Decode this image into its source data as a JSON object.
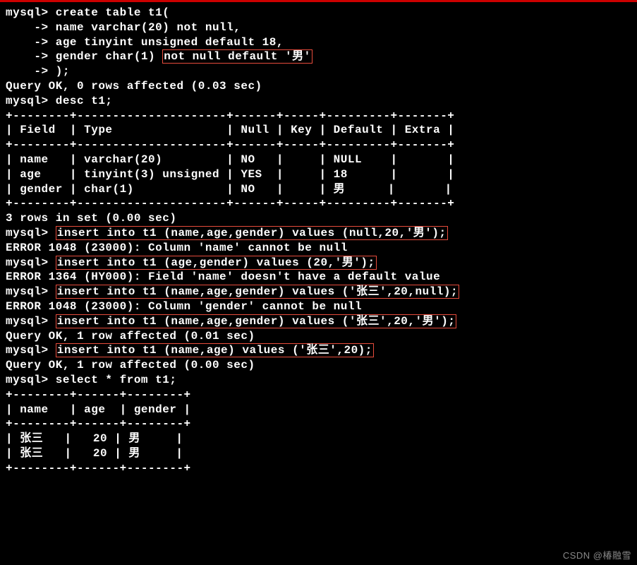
{
  "lines": {
    "l1": "mysql> create table t1(",
    "l2": "    -> name varchar(20) not null,",
    "l3": "    -> age tinyint unsigned default 18,",
    "l4a": "    -> gender char(1) ",
    "l4b": "not null default '男'",
    "l5": "    -> );",
    "l6": "Query OK, 0 rows affected (0.03 sec)",
    "l7": "",
    "l8": "mysql> desc t1;",
    "l9": "+--------+---------------------+------+-----+---------+-------+",
    "l10": "| Field  | Type                | Null | Key | Default | Extra |",
    "l11": "+--------+---------------------+------+-----+---------+-------+",
    "l12": "| name   | varchar(20)         | NO   |     | NULL    |       |",
    "l13": "| age    | tinyint(3) unsigned | YES  |     | 18      |       |",
    "l14": "| gender | char(1)             | NO   |     | 男      |       |",
    "l15": "+--------+---------------------+------+-----+---------+-------+",
    "l16": "3 rows in set (0.00 sec)",
    "l17": "",
    "l18a": "mysql> ",
    "l18b": "insert into t1 (name,age,gender) values (null,20,'男');",
    "l19": "ERROR 1048 (23000): Column 'name' cannot be null",
    "l20a": "mysql> ",
    "l20b": "insert into t1 (age,gender) values (20,'男');",
    "l21": "ERROR 1364 (HY000): Field 'name' doesn't have a default value",
    "l22a": "mysql> ",
    "l22b": "insert into t1 (name,age,gender) values ('张三',20,null);",
    "l23": "ERROR 1048 (23000): Column 'gender' cannot be null",
    "l24a": "mysql> ",
    "l24b": "insert into t1 (name,age,gender) values ('张三',20,'男');",
    "l25": "Query OK, 1 row affected (0.01 sec)",
    "l26": "",
    "l27a": "mysql> ",
    "l27b": "insert into t1 (name,age) values ('张三',20);",
    "l28": "Query OK, 1 row affected (0.00 sec)",
    "l29": "",
    "l30": "mysql> select * from t1;",
    "l31": "+--------+------+--------+",
    "l32": "| name   | age  | gender |",
    "l33": "+--------+------+--------+",
    "l34": "| 张三   |   20 | 男     |",
    "l35": "| 张三   |   20 | 男     |",
    "l36": "+--------+------+--------+"
  },
  "watermark": "CSDN @椿融雪"
}
